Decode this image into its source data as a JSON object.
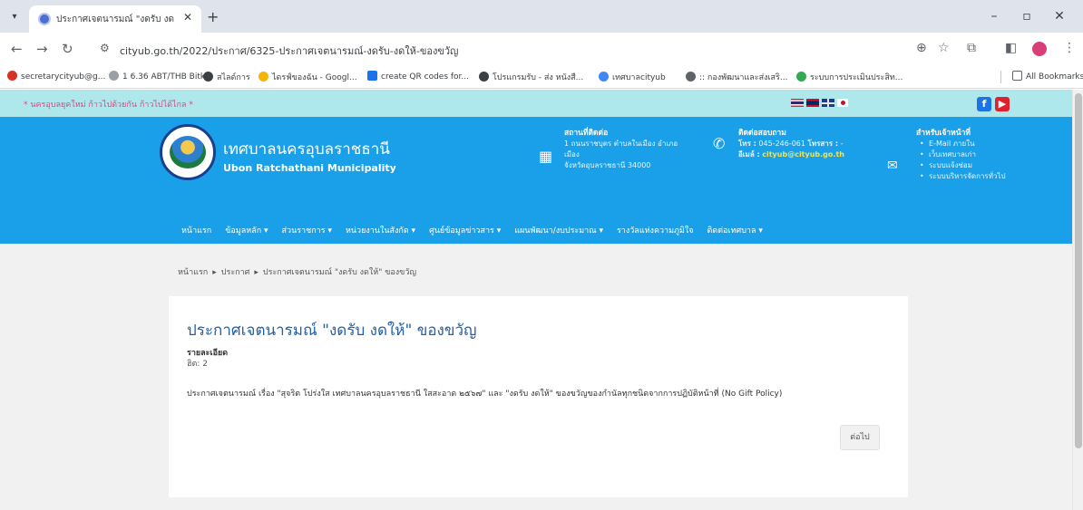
{
  "browser": {
    "tab_title": "ประกาศเจตนารมณ์ \"งดรับ งดให้\" ขอ",
    "url": "cityub.go.th/2022/ประกาศ/6325-ประกาศเจตนารมณ์-งดรับ-งดให้-ของขวัญ",
    "bookmarks": [
      "secretarycityub@g...",
      "1 6.36 ABT/THB Bitk...",
      "สไลด์การ",
      "ไดรฟ์ของฉัน - Googl...",
      "create QR codes for...",
      "โปรแกรมรับ - ส่ง หนังสื...",
      "เทศบาลcityub",
      ":: กองพัฒนาและส่งเสริ...",
      "ระบบการประเมินประสิท..."
    ],
    "all_bookmarks": "All Bookmarks"
  },
  "site": {
    "tagline": "* นครอุบลยุคใหม่ ก้าวไปด้วยกัน ก้าวไปได้ไกล *",
    "name_th": "เทศบาลนครอุบลราชธานี",
    "name_en": "Ubon Ratchathani Municipality",
    "address_head": "สถานที่ติดต่อ",
    "address_line1": "1 ถนนราชบุตร ตำบลในเมือง อำเภอ",
    "address_line2": "เมือง",
    "address_line3": "จังหวัดอุบลราชธานี 34000",
    "contact_head": "ติดต่อสอบถาม",
    "tel_label": "โทร :",
    "tel_value": "045-246-061",
    "fax_label": "โทรสาร :",
    "fax_value": "-",
    "email_label": "อีเมล์ :",
    "email_value": "cityub@cityub.go.th",
    "staff_head": "สำหรับเจ้าหน้าที่",
    "staff_links": [
      "E-Mail ภายใน",
      "เว็บเทศบาลเก่า",
      "ระบบแจ้งซ่อม",
      "ระบบบริหารจัดการทั่วไป"
    ],
    "nav": [
      "หน้าแรก",
      "ข้อมูลหลัก ▾",
      "ส่วนราชการ ▾",
      "หน่วยงานในสังกัด ▾",
      "ศูนย์ข้อมูลข่าวสาร ▾",
      "แผนพัฒนา/งบประมาณ ▾",
      "รางวัลแห่งความภูมิใจ",
      "ติดต่อเทศบาล ▾"
    ]
  },
  "breadcrumb": {
    "home": "หน้าแรก",
    "section": "ประกาศ",
    "current": "ประกาศเจตนารมณ์ \"งดรับ งดให้\" ของขวัญ"
  },
  "article": {
    "title": "ประกาศเจตนารมณ์ \"งดรับ งดให้\" ของขวัญ",
    "details_label": "รายละเอียด",
    "hits": "ฮิต: 2",
    "body": "ประกาศเจตนารมณ์ เรื่อง \"สุจริต โปร่งใส เทศบาลนครอุบลราชธานี ใสสะอาด ๒๕๖๗\" และ \"งดรับ งดให้\" ของขวัญของกำนัลทุกชนิดจากการปฏิบัติหน้าที่ (No Gift Policy)",
    "next": "ต่อไป"
  },
  "colors": {
    "header_blue": "#1aa0e8",
    "top_strip": "#aee7ec",
    "title_blue": "#2360a5",
    "tagline_pink": "#d94b7d"
  }
}
